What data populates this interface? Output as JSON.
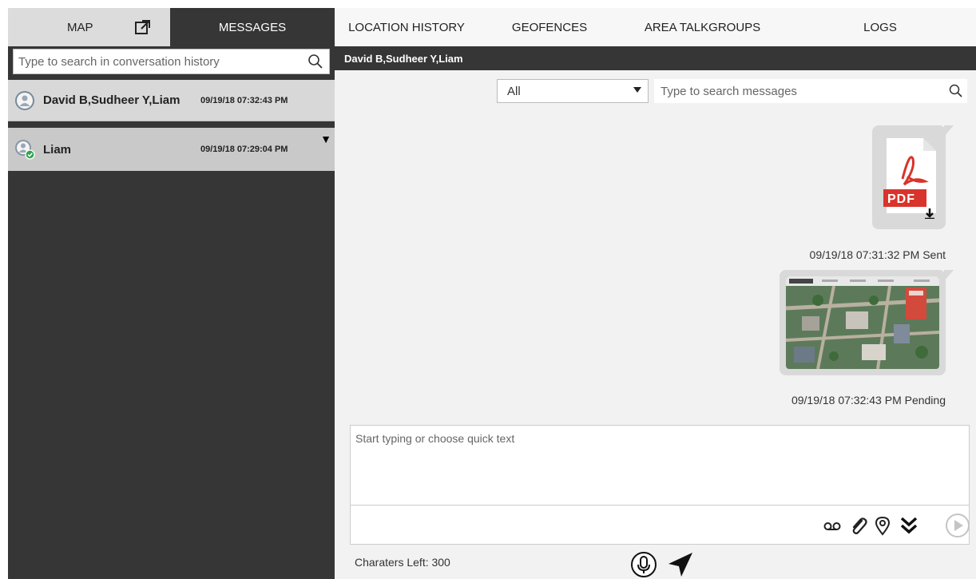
{
  "tabs": {
    "map": "MAP",
    "messages": "MESSAGES",
    "location_history": "LOCATION HISTORY",
    "geofences": "GEOFENCES",
    "area_talkgroups": "AREA TALKGROUPS",
    "logs": "LOGS"
  },
  "conversations": {
    "search_placeholder": "Type to search in conversation history",
    "items": [
      {
        "name": "David B,Sudheer Y,Liam",
        "time": "09/19/18 07:32:43 PM"
      },
      {
        "name": "Liam",
        "time": "09/19/18 07:29:04 PM"
      }
    ]
  },
  "thread": {
    "title": "David B,Sudheer Y,Liam",
    "filter_selected": "All",
    "search_placeholder": "Type to search messages",
    "messages": [
      {
        "type": "file",
        "file_label": "PDF",
        "meta": "09/19/18 07:31:32 PM Sent"
      },
      {
        "type": "image",
        "meta": "09/19/18 07:32:43 PM Pending"
      }
    ]
  },
  "composer": {
    "placeholder": "Start typing or choose quick text",
    "chars_left": "Charaters Left: 300"
  },
  "colors": {
    "dark_panel": "#363636",
    "selected_row": "#d8d8d8",
    "pdf_red": "#d9342b",
    "presence_green": "#2ea44f"
  }
}
